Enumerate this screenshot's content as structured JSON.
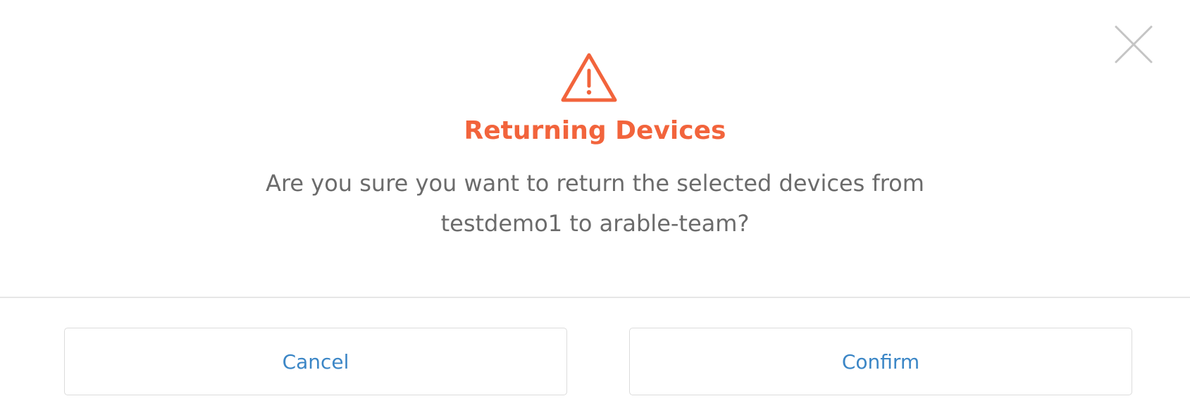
{
  "dialog": {
    "close_icon": "close-icon",
    "warning_icon": "warning-triangle-icon",
    "title": "Returning Devices",
    "message_line1": "Are you sure you want to return the selected devices from",
    "message_line2": "testdemo1 to arable-team?",
    "cancel_label": "Cancel",
    "confirm_label": "Confirm"
  },
  "colors": {
    "accent": "#f2643c",
    "button_text": "#3b86c6",
    "message_text": "#6b6b6b",
    "close_icon": "#c4c4c4"
  }
}
